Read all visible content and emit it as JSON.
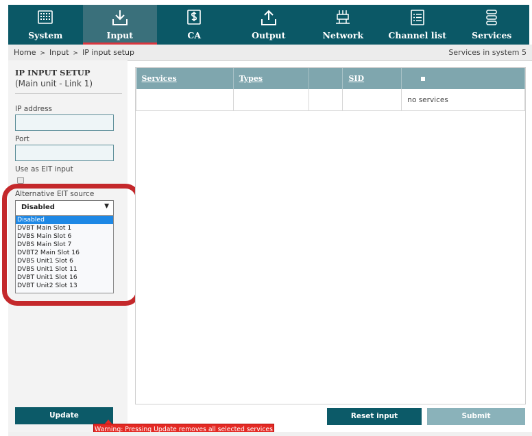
{
  "nav": {
    "items": [
      {
        "label": "System",
        "icon": "grid-icon"
      },
      {
        "label": "Input",
        "icon": "download-tray-icon",
        "active": true
      },
      {
        "label": "CA",
        "icon": "dollar-box-icon"
      },
      {
        "label": "Output",
        "icon": "upload-tray-icon"
      },
      {
        "label": "Network",
        "icon": "network-icon"
      },
      {
        "label": "Channel list",
        "icon": "list-icon"
      },
      {
        "label": "Services",
        "icon": "services-icon"
      }
    ],
    "active_color": "#d9363e"
  },
  "breadcrumb": {
    "home": "Home",
    "input": "Input",
    "current": "IP input setup",
    "separator": ">",
    "services_in_system": "Services in system 5"
  },
  "left": {
    "title": "IP INPUT SETUP",
    "subtitle": "(Main unit - Link 1)",
    "ip_label": "IP address",
    "ip_value": "",
    "port_label": "Port",
    "port_value": "",
    "eit_label": "Use as EIT input",
    "alt_eit_label": "Alternative EIT source",
    "alt_eit_selected": "Disabled",
    "alt_eit_options": [
      "Disabled",
      "DVBT Main Slot 1",
      "DVBS Main Slot 6",
      "DVBS Main Slot 7",
      "DVBT2 Main Slot 16",
      "DVBS Unit1 Slot 6",
      "DVBS Unit1 Slot 11",
      "DVBT Unit1 Slot 16",
      "DVBT Unit2 Slot 13"
    ]
  },
  "table": {
    "columns": [
      "Services",
      "Types",
      "",
      "SID"
    ],
    "empty_text": "no services"
  },
  "buttons": {
    "update": "Update",
    "reset": "Reset input",
    "submit": "Submit"
  },
  "warning": "Warning: Pressing Update removes all selected services",
  "colors": {
    "nav_bg": "#0b5866",
    "button_bg": "#0c5a68",
    "table_header_bg": "#7fa6ae",
    "warning_bg": "#e42a24",
    "highlight": "#c4282b"
  }
}
